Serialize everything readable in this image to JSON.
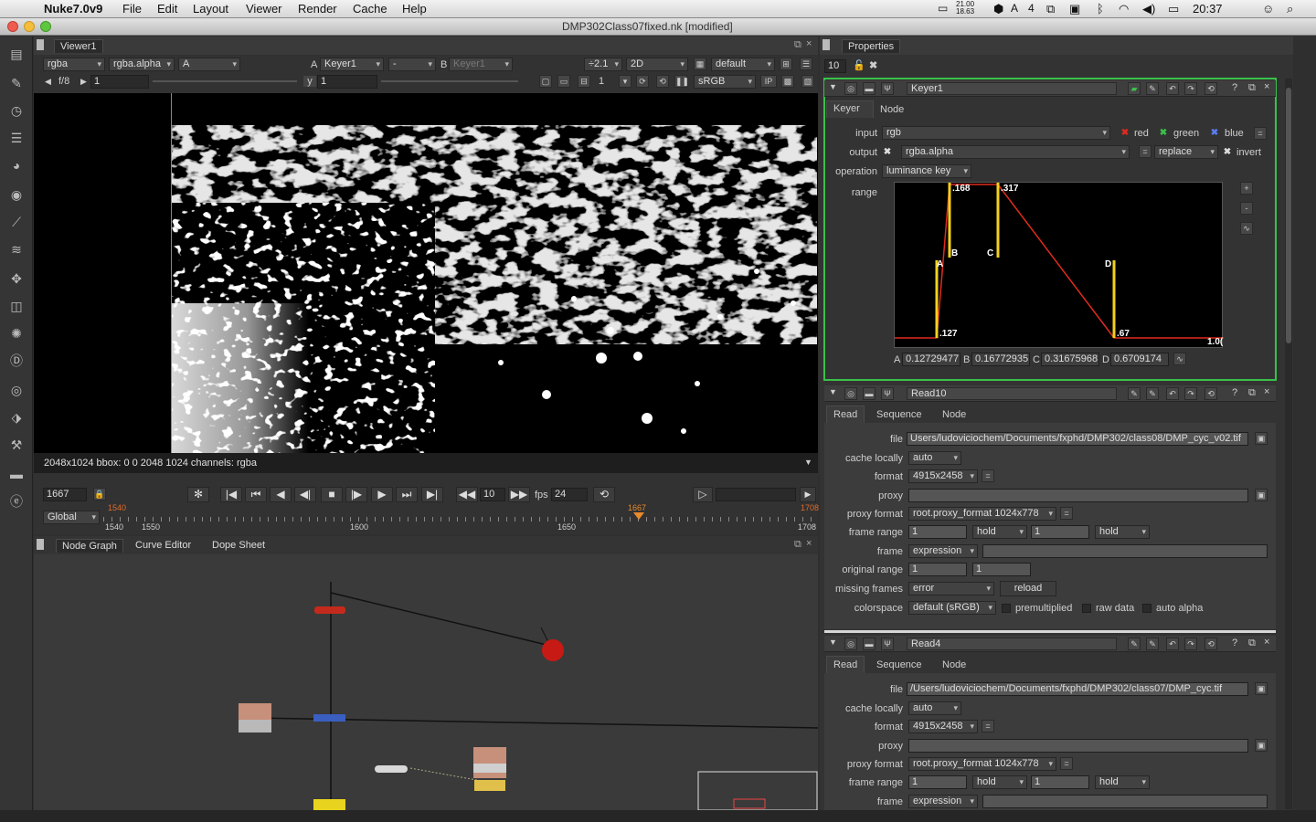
{
  "menubar": {
    "app": "Nuke7.0v9",
    "items": [
      "File",
      "Edit",
      "Layout",
      "Viewer",
      "Render",
      "Cache",
      "Help"
    ],
    "clock": "20:37",
    "input_badge": "4",
    "sys_small": "21.00 18.63"
  },
  "window": {
    "title": "DMP302Class07fixed.nk [modified]"
  },
  "viewer": {
    "tab": "Viewer1",
    "channels": "rgba",
    "channel_alpha": "rgba.alpha",
    "display": "A",
    "a_label": "A",
    "a_input": "Keyer1",
    "op": "-",
    "b_label": "B",
    "b_input": "Keyer1",
    "zoom": "÷2.1",
    "view_mode": "2D",
    "lut_input": "default",
    "fstop": "f/8",
    "gain": "1",
    "y_label": "y",
    "gamma": "1",
    "frame_proxy": "1",
    "colorspace": "sRGB",
    "ip": "IP",
    "info": "2048x1024 bbox: 0 0 2048 1024 channels: rgba"
  },
  "timeline": {
    "frame": "1667",
    "inc": "10",
    "fps_label": "fps",
    "fps": "24",
    "scope": "Global",
    "start": "1540",
    "end": "1708",
    "current_marker": "1667",
    "in_marker": "1540",
    "out_marker": "1708",
    "ticks": [
      "1540",
      "1550",
      "1600",
      "1650",
      "1708"
    ]
  },
  "nodegraph": {
    "tabs": [
      "Node Graph",
      "Curve Editor",
      "Dope Sheet"
    ]
  },
  "properties": {
    "tab": "Properties",
    "max_panels": "10",
    "keyer": {
      "name": "Keyer1",
      "tabs": [
        "Keyer",
        "Node"
      ],
      "input_label": "input",
      "input": "rgb",
      "red": "red",
      "green": "green",
      "blue": "blue",
      "output_label": "output",
      "output": "rgba.alpha",
      "output_mode": "replace",
      "invert": "invert",
      "operation_label": "operation",
      "operation": "luminance key",
      "range_label": "range",
      "graph_labels": {
        "top_b": ".168",
        "top_c": ".317",
        "bot_a": ".127",
        "bot_d": ".67",
        "right": "1.0("
      },
      "points": {
        "A": "A",
        "B": "B",
        "C": "C",
        "D": "D"
      },
      "a_val": "0.12729477",
      "b_val": "0.16772935",
      "c_val": "0.31675968",
      "d_val": "0.6709174",
      "curve": {
        "A": 0.12729477,
        "B": 0.16772935,
        "C": 0.31675968,
        "D": 0.6709174
      }
    },
    "read10": {
      "name": "Read10",
      "tabs": [
        "Read",
        "Sequence",
        "Node"
      ],
      "file": "Users/ludoviciochem/Documents/fxphd/DMP302/class08/DMP_cyc_v02.tif",
      "cache": "auto",
      "format": "4915x2458",
      "proxy": "",
      "proxy_format": "root.proxy_format 1024x778",
      "frame_range_start": "1",
      "frame_range_end": "1",
      "hold_before": "hold",
      "hold_after": "hold",
      "frame_mode": "expression",
      "original_range_start": "1",
      "original_range_end": "1",
      "missing_frames": "error",
      "reload": "reload",
      "colorspace": "default (sRGB)",
      "premultiplied": "premultiplied",
      "raw_data": "raw data",
      "auto_alpha": "auto alpha"
    },
    "read4": {
      "name": "Read4",
      "tabs": [
        "Read",
        "Sequence",
        "Node"
      ],
      "file": "/Users/ludoviciochem/Documents/fxphd/DMP302/class07/DMP_cyc.tif",
      "cache": "auto",
      "format": "4915x2458",
      "proxy": "",
      "proxy_format": "root.proxy_format 1024x778",
      "frame_range_start": "1",
      "frame_range_end": "1",
      "hold_before": "hold",
      "hold_after": "hold",
      "frame_mode": "expression"
    },
    "labels": {
      "file": "file",
      "cache": "cache locally",
      "format": "format",
      "proxy": "proxy",
      "proxy_format": "proxy format",
      "frame_range": "frame range",
      "frame": "frame",
      "original_range": "original range",
      "missing_frames": "missing frames",
      "colorspace": "colorspace"
    }
  },
  "colors": {
    "accent_green": "#39c24a",
    "key_red": "#e02a1e",
    "key_yellow": "#f5d11d"
  }
}
